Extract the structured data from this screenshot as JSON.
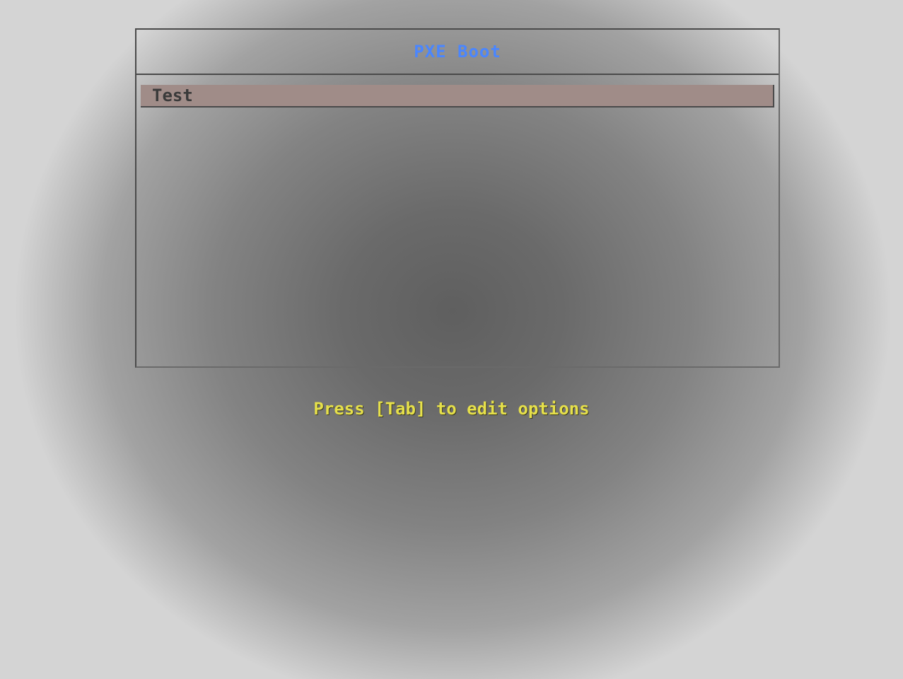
{
  "menu": {
    "title": "PXE Boot",
    "items": [
      {
        "label": "Test",
        "selected": true
      }
    ]
  },
  "hint": "Press [Tab] to edit options",
  "colors": {
    "title": "#4a86ff",
    "hint": "#e6e04a",
    "selected_bg": "#a08c88"
  }
}
